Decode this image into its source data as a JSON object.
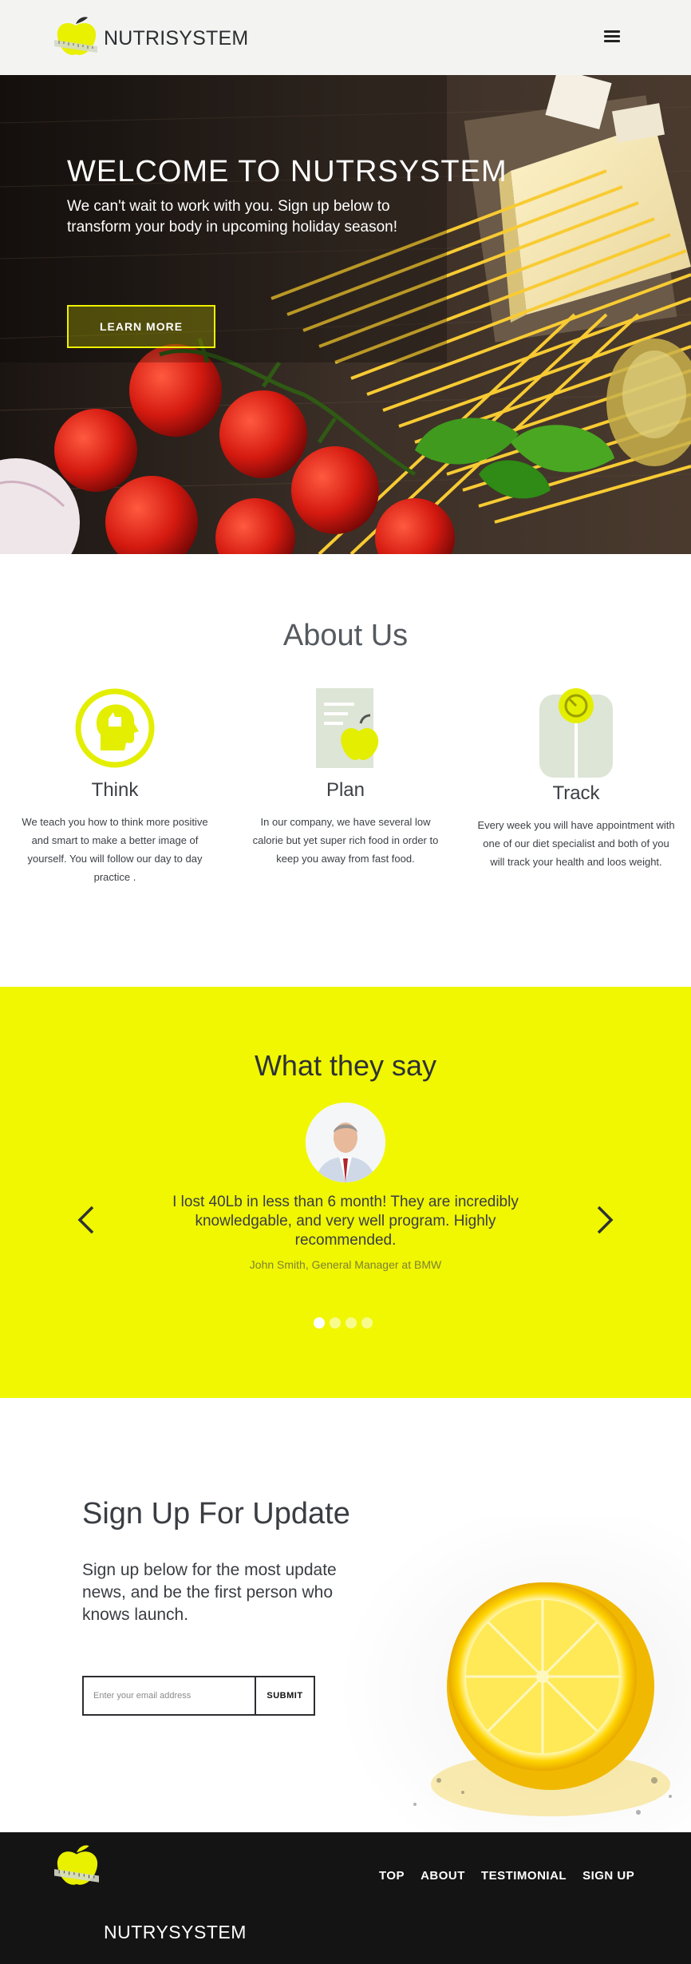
{
  "header": {
    "brand": "NUTRISYSTEM",
    "menu_icon": "hamburger-menu-icon"
  },
  "hero": {
    "title": "WELCOME TO NUTRSYSTEM",
    "subtitle": "We can't wait to work with you. Sign up below to transform your body in upcoming holiday season!",
    "button_label": "LEARN MORE"
  },
  "about": {
    "title": "About Us",
    "features": [
      {
        "icon": "head-thumbs-up-icon",
        "title": "Think",
        "text": "We teach you how to think more positive and smart to make a better image of yourself. You will follow our day to day practice ."
      },
      {
        "icon": "document-apple-icon",
        "title": "Plan",
        "text": "In our company, we have several low calorie but yet super rich food in order to keep you away from fast food."
      },
      {
        "icon": "scale-icon",
        "title": "Track",
        "text": "Every week you will have appointment with one of our diet specialist and both of you will track your health and loos weight."
      }
    ]
  },
  "testimonials": {
    "title": "What they say",
    "quote": "I lost 40Lb in less than 6 month! They are incredibly knowledgable, and very well program. Highly recommended.",
    "author": "John Smith, General Manager at BMW",
    "slide_count": 4,
    "active_slide": 1
  },
  "signup": {
    "title": "Sign Up For Update",
    "text": "Sign up below for the most update news, and be the first person who knows launch.",
    "email_placeholder": "Enter your email address",
    "email_value": "",
    "submit_label": "SUBMIT"
  },
  "footer": {
    "brand": "NUTRYSYSTEM",
    "nav": [
      "TOP",
      "ABOUT",
      "TESTIMONIAL",
      "SIGN UP"
    ]
  },
  "colors": {
    "accent": "#f0f700",
    "dark": "#141414",
    "header_bg": "#f3f4f2",
    "text": "#3c4046",
    "icon_green": "#dde5d6"
  }
}
